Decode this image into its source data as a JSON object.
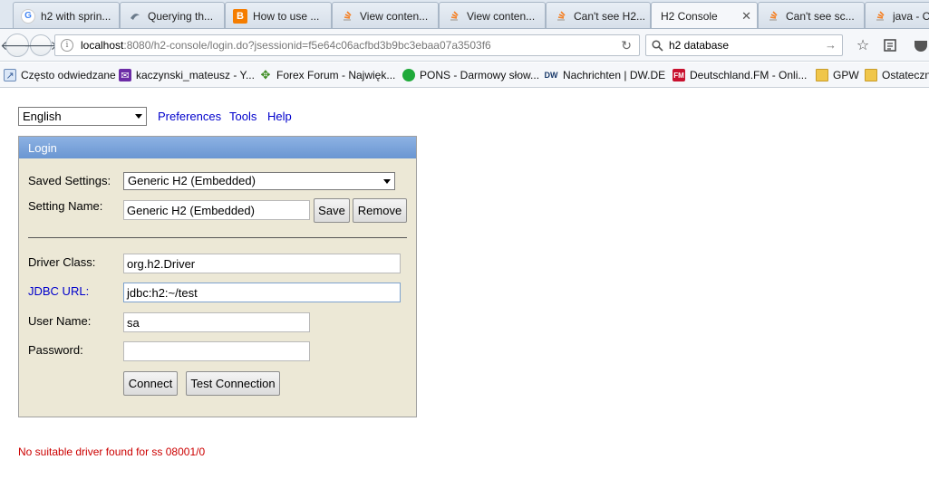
{
  "browser": {
    "tabs": [
      {
        "title": "h2 with sprin...",
        "icon": "google-icon"
      },
      {
        "title": "Querying th...",
        "icon": "querying-icon"
      },
      {
        "title": "How to use ...",
        "icon": "blogger-icon"
      },
      {
        "title": "View conten...",
        "icon": "stackoverflow-icon"
      },
      {
        "title": "View conten...",
        "icon": "stackoverflow-icon"
      },
      {
        "title": "Can't see H2...",
        "icon": "stackoverflow-icon"
      },
      {
        "title": "H2 Console",
        "icon": "none",
        "active": true
      },
      {
        "title": "Can't see sc...",
        "icon": "stackoverflow-icon"
      },
      {
        "title": "java - C",
        "icon": "stackoverflow-icon"
      }
    ],
    "url_host": "localhost",
    "url_path": ":8080/h2-console/login.do?jsessionid=f5e64c06acfbd3b9bc3ebaa07a3503f6",
    "search_value": "h2 database",
    "bookmarks": [
      {
        "label": "Często odwiedzane",
        "icon": "mostvisited-icon"
      },
      {
        "label": "kaczynski_mateusz - Y...",
        "icon": "yahoo-mail-icon"
      },
      {
        "label": "Forex Forum - Najwięk...",
        "icon": "forex-icon"
      },
      {
        "label": "PONS - Darmowy słow...",
        "icon": "pons-icon"
      },
      {
        "label": "Nachrichten | DW.DE",
        "icon": "dw-icon"
      },
      {
        "label": "Deutschland.FM - Onli...",
        "icon": "fm-icon"
      },
      {
        "label": "GPW",
        "icon": "folder-icon"
      },
      {
        "label": "Ostateczn",
        "icon": "folder-icon"
      }
    ]
  },
  "page": {
    "language": "English",
    "links": {
      "preferences": "Preferences",
      "tools": "Tools",
      "help": "Help"
    },
    "login": {
      "header": "Login",
      "saved_settings_label": "Saved Settings:",
      "saved_settings_value": "Generic H2 (Embedded)",
      "setting_name_label": "Setting Name:",
      "setting_name_value": "Generic H2 (Embedded)",
      "save_label": "Save",
      "remove_label": "Remove",
      "driver_class_label": "Driver Class:",
      "driver_class_value": "org.h2.Driver",
      "jdbc_url_label": "JDBC URL:",
      "jdbc_url_value": "jdbc:h2:~/test",
      "user_name_label": "User Name:",
      "user_name_value": "sa",
      "password_label": "Password:",
      "password_value": "",
      "connect_label": "Connect",
      "test_connection_label": "Test Connection"
    },
    "error": "No suitable driver found for ss 08001/0"
  },
  "colors": {
    "link": "#0000cc",
    "error": "#cc0000",
    "login_header": "#7aa3da",
    "login_bg": "#ece8d6"
  }
}
